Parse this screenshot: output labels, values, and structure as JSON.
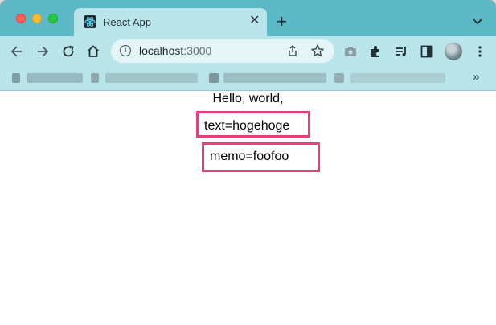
{
  "browser": {
    "tab": {
      "title": "React App",
      "favicon": "react-logo-icon",
      "close_glyph": "✕"
    },
    "new_tab_glyph": "+",
    "tab_search_glyph": "⌄",
    "address_bar": {
      "host": "localhost",
      "port": ":3000"
    },
    "bookmarks_overflow_glyph": "»",
    "colors": {
      "tabstrip": "#5bb8c4",
      "toolbar": "#b9e5ea",
      "highlight_box": "#e83e7a"
    }
  },
  "page": {
    "greeting": "Hello, world,",
    "text_line": "text=hogehoge",
    "memo_line": "memo=foofoo"
  }
}
